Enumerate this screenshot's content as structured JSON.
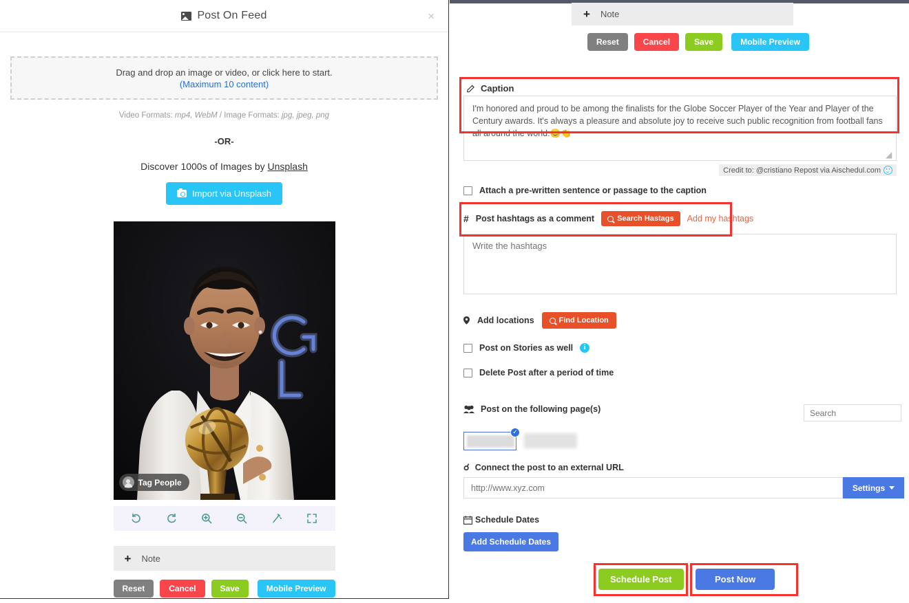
{
  "left_modal": {
    "title": "Post On Feed",
    "close_label": "×",
    "dropzone": {
      "line1": "Drag and drop an image or video, or click here to start.",
      "line2": "(Maximum 10 content)"
    },
    "formats_prefix": "Video Formats:",
    "formats_video": "mp4, WebM",
    "formats_mid": "/ Image Formats:",
    "formats_image": "jpg, jpeg, png",
    "or_text": "-OR-",
    "discover_prefix": "Discover 1000s of Images by ",
    "discover_link": "Unsplash",
    "import_button": "Import via Unsplash",
    "tag_people": "Tag People",
    "toolbar_icons": [
      "rotate-left-icon",
      "rotate-right-icon",
      "zoom-in-icon",
      "zoom-out-icon",
      "magic-wand-icon",
      "expand-icon"
    ],
    "note_label": "Note",
    "note_plus": "+",
    "buttons": {
      "reset": "Reset",
      "cancel": "Cancel",
      "save": "Save",
      "mobile_preview": "Mobile Preview"
    }
  },
  "right_panel": {
    "note_label": "Note",
    "note_plus": "+",
    "buttons": {
      "reset": "Reset",
      "cancel": "Cancel",
      "save": "Save",
      "mobile_preview": "Mobile Preview"
    },
    "caption": {
      "label": "Caption",
      "value": "I'm honored and proud to be among the finalists for the Globe Soccer Player of the Year and Player of the Century awards. It's always a pleasure and absolute joy to receive such public recognition from football fans all around the world.😊👏",
      "credit": "Credit to: @cristiano Repost via Aischedul.com"
    },
    "prewritten_checkbox": "Attach a pre-written sentence or passage to the caption",
    "hashtags": {
      "label": "Post hashtags as a comment",
      "search_button": "Search Hastags",
      "add_link": "Add my hashtags",
      "placeholder": "Write the hashtags",
      "value": ""
    },
    "locations": {
      "label": "Add locations",
      "find_button": "Find Location"
    },
    "stories_checkbox": "Post on Stories as well",
    "delete_checkbox": "Delete Post after a period of time",
    "pages": {
      "label": "Post on the following page(s)",
      "search_placeholder": "Search",
      "search_value": "",
      "items": [
        {
          "name": "page-thumbnail-selected",
          "selected": true,
          "check": "✓"
        },
        {
          "name": "page-thumbnail",
          "selected": false,
          "check": ""
        }
      ]
    },
    "external_url": {
      "label": "Connect the post to an external URL",
      "placeholder": "http://www.xyz.com",
      "value": "",
      "settings_button": "Settings"
    },
    "schedule": {
      "label": "Schedule Dates",
      "add_button": "Add Schedule Dates"
    },
    "footer": {
      "schedule_post": "Schedule Post",
      "post_now": "Post Now"
    }
  },
  "colors": {
    "accent_cyan": "#29c5f6",
    "accent_green": "#8ccc21",
    "accent_red": "#f9464b",
    "accent_orange": "#e8502a",
    "accent_blue": "#4b79e4",
    "highlight_red": "#f5322e",
    "gray_button": "#808080",
    "link_blue": "#2b6fd4"
  }
}
